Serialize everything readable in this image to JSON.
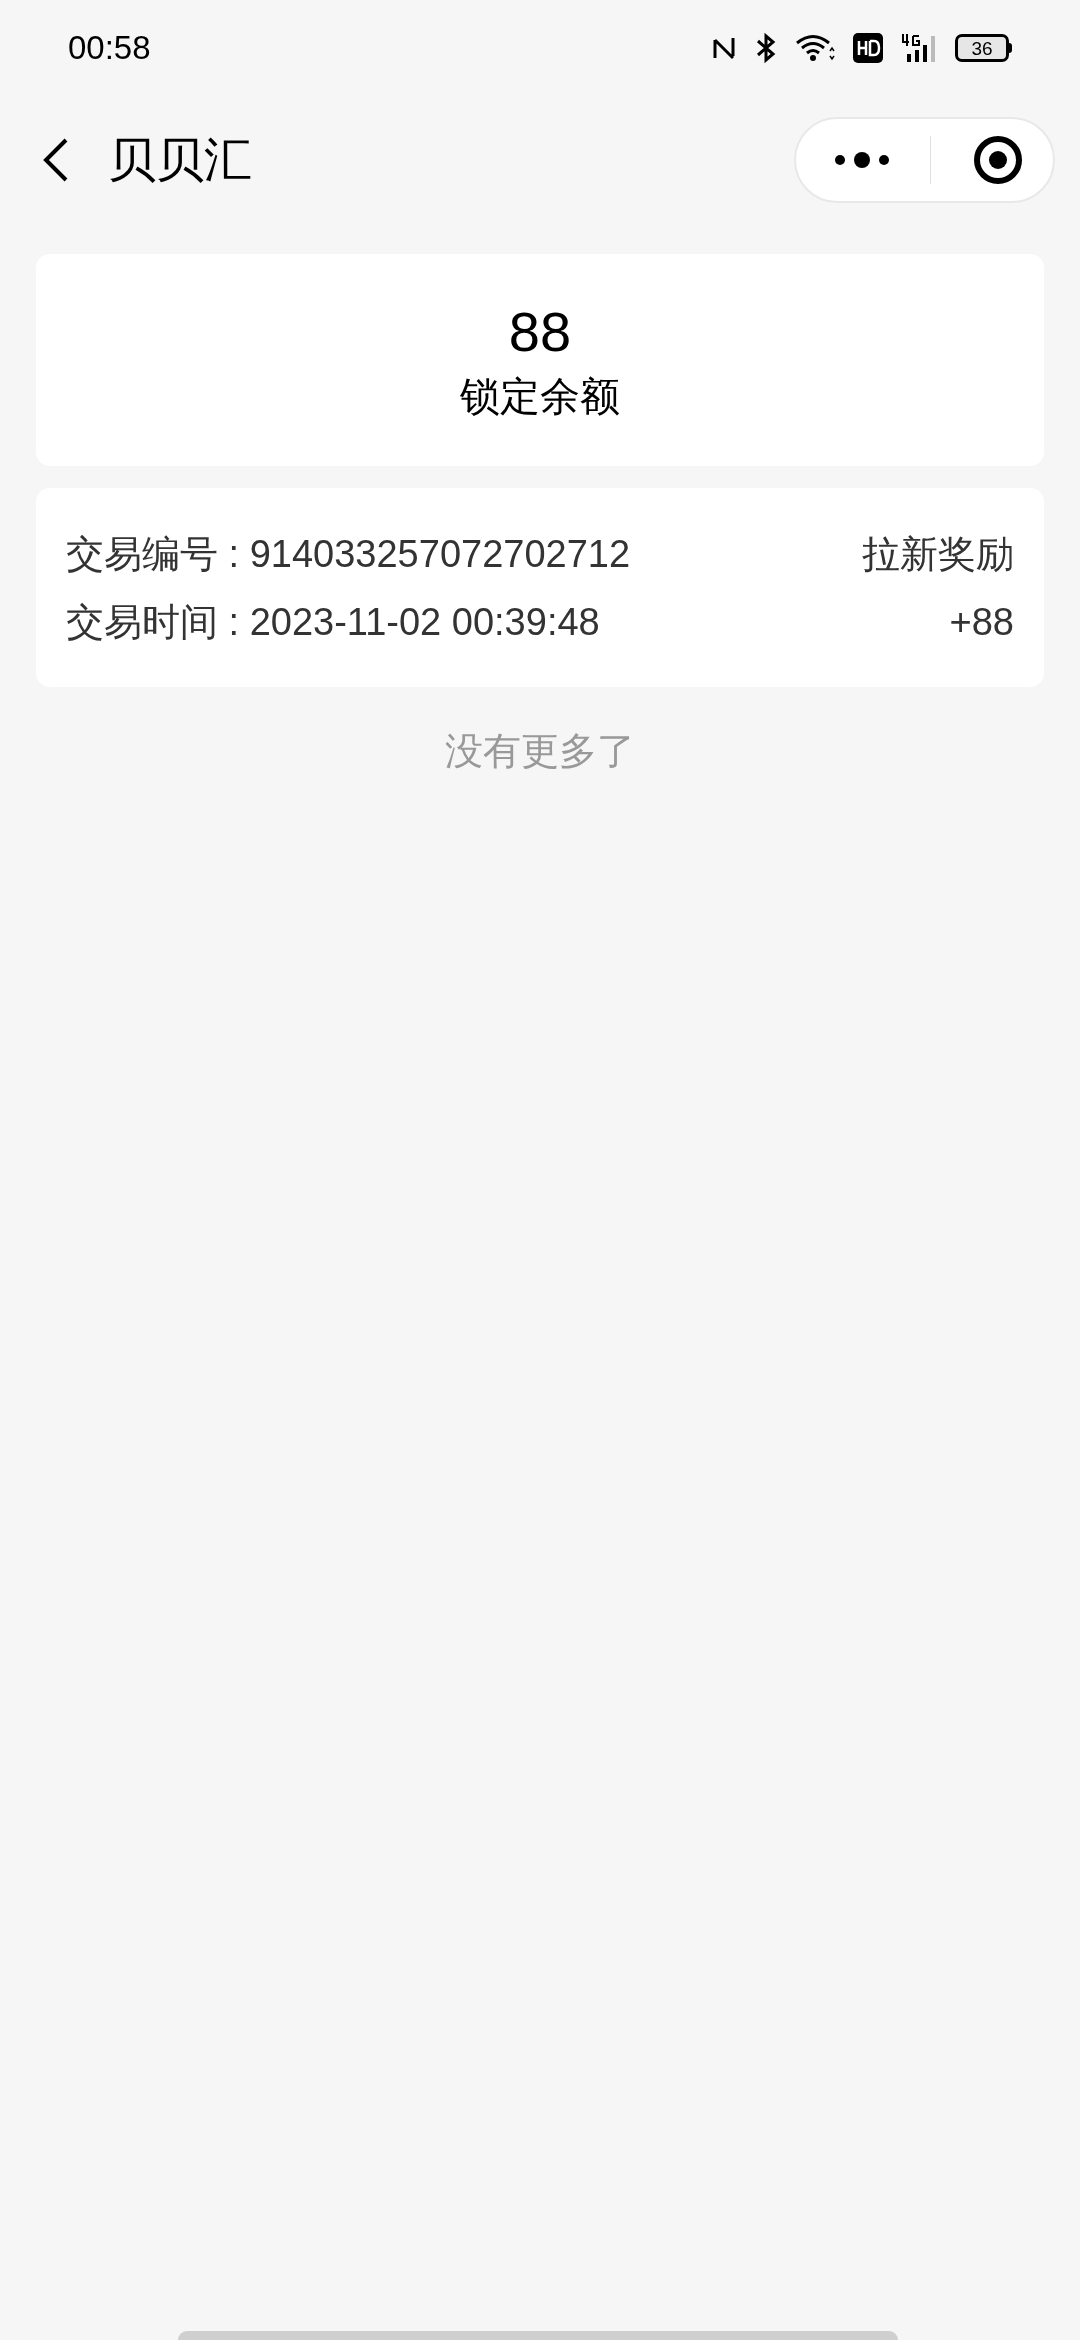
{
  "status_bar": {
    "time": "00:58",
    "battery": "36"
  },
  "header": {
    "title": "贝贝汇"
  },
  "balance": {
    "amount": "88",
    "label": "锁定余额"
  },
  "transactions": [
    {
      "id_text": "交易编号 : 914033257072702712",
      "time_text": "交易时间 : 2023-11-02 00:39:48",
      "type": "拉新奖励",
      "amount": "+88"
    }
  ],
  "footer": {
    "text": "没有更多了"
  }
}
